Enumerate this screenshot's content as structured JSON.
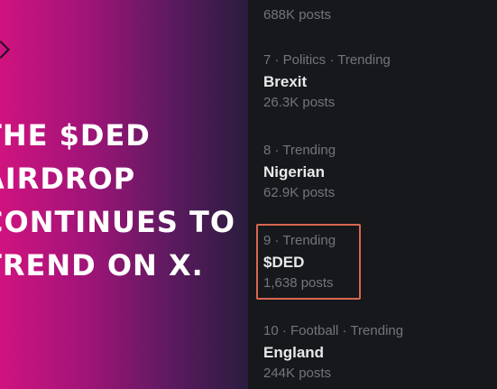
{
  "headline": {
    "lines": [
      "THE $DED",
      "AIRDROP",
      "CONTINUES TO",
      "TREND ON X."
    ]
  },
  "trends": {
    "prev_count": "688K posts",
    "items": [
      {
        "meta": "7 · Politics · Trending",
        "title": "Brexit",
        "count": "26.3K posts"
      },
      {
        "meta": "8 · Trending",
        "title": "Nigerian",
        "count": "62.9K posts"
      },
      {
        "meta": "9 · Trending",
        "title": "$DED",
        "count": "1,638 posts"
      },
      {
        "meta": "10 · Football · Trending",
        "title": "England",
        "count": "244K posts"
      }
    ]
  },
  "colors": {
    "highlight_border": "#d9674f",
    "panel_bg": "#16181c",
    "gradient_start": "#d0137f",
    "gradient_end": "#2a1c3e"
  }
}
